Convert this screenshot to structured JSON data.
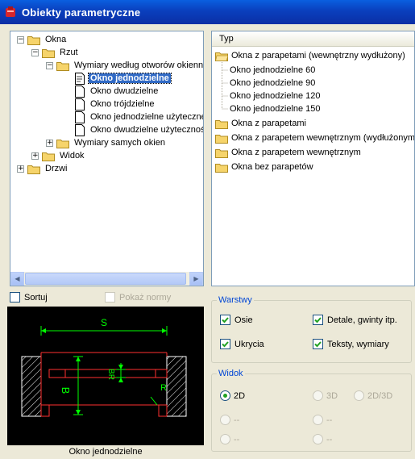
{
  "window": {
    "title": "Obiekty parametryczne"
  },
  "tree": {
    "items": [
      {
        "label": "Okna"
      },
      {
        "label": "Rzut"
      },
      {
        "label": "Wymiary według otworów okiennych"
      },
      {
        "label": "Okno jednodzielne"
      },
      {
        "label": "Okno dwudzielne"
      },
      {
        "label": "Okno trójdzielne"
      },
      {
        "label": "Okno jednodzielne użyteczne"
      },
      {
        "label": "Okno dwudzielne użyteczność"
      },
      {
        "label": "Wymiary samych okien"
      },
      {
        "label": "Widok"
      },
      {
        "label": "Drzwi"
      }
    ]
  },
  "list": {
    "header": "Typ",
    "items": [
      {
        "label": "Okna z parapetami (wewnętrzny wydłużony)"
      },
      {
        "label": "Okno jednodzielne  60"
      },
      {
        "label": "Okno jednodzielne  90"
      },
      {
        "label": "Okno jednodzielne  120"
      },
      {
        "label": "Okno jednodzielne  150"
      },
      {
        "label": "Okna z parapetami"
      },
      {
        "label": "Okna z parapetem wewnętrznym (wydłużonym)"
      },
      {
        "label": "Okna z parapetem wewnętrznym"
      },
      {
        "label": "Okna bez parapetów"
      }
    ]
  },
  "options": {
    "sort_label": "Sortuj",
    "norms_label": "Pokaż normy"
  },
  "preview": {
    "caption": "Okno jednodzielne",
    "dims": {
      "s": "S",
      "b": "B",
      "br": "BR",
      "r": "R"
    }
  },
  "layers": {
    "title": "Warstwy",
    "osie": "Osie",
    "detale": "Detale, gwinty itp.",
    "ukrycia": "Ukrycia",
    "teksty": "Teksty, wymiary"
  },
  "view": {
    "title": "Widok",
    "opt_2d": "2D",
    "opt_3d": "3D",
    "opt_2d3d": "2D/3D",
    "opt_a": "--",
    "opt_b": "--",
    "opt_c": "--",
    "opt_d": "--"
  },
  "colors": {
    "selection": "#316ac5",
    "titlebar": "#0a3fbd",
    "group_title": "#0046d5",
    "drawing_lines": "#ff3030",
    "drawing_dims": "#00ff00"
  }
}
